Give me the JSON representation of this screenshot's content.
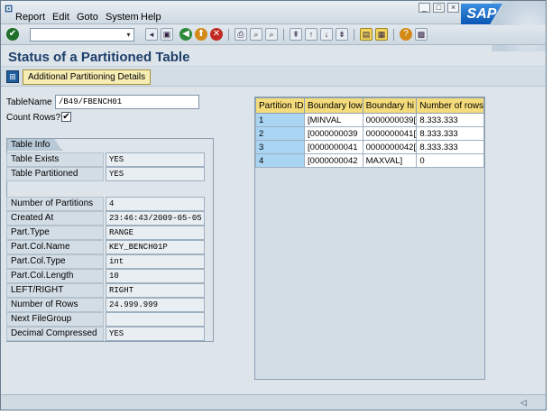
{
  "menu": {
    "items": [
      "Report",
      "Edit",
      "Goto",
      "System",
      "Help"
    ]
  },
  "window_buttons": [
    "minimize-icon",
    "restore-icon",
    "close-icon"
  ],
  "logo": "SAP",
  "toolbar": {
    "command_field_value": "",
    "icons": [
      "enter-icon",
      "save-icon",
      "back-icon",
      "exit-icon",
      "cancel-icon",
      "print-icon",
      "find-icon",
      "find-next-icon",
      "first-page-icon",
      "previous-page-icon",
      "next-page-icon",
      "last-page-icon",
      "new-session-icon",
      "shortcut-icon",
      "help-icon",
      "layout-icon"
    ]
  },
  "page": {
    "title": "Status of a Partitioned Table"
  },
  "app_toolbar": {
    "button_label": "Additional Partitioning Details"
  },
  "form": {
    "table_name_label": "TableName",
    "table_name_value": "/B49/FBENCH01",
    "count_rows_label": "Count Rows?",
    "count_rows_checked": true,
    "count_rows_mark": "✔"
  },
  "table_info": {
    "title": "Table Info",
    "rows": [
      {
        "label": "Table Exists",
        "value": "YES"
      },
      {
        "label": "Table Partitioned",
        "value": "YES"
      },
      {
        "label": "Number of Partitions",
        "value": "4"
      },
      {
        "label": "Created At",
        "value": "23:46:43/2009-05-05"
      },
      {
        "label": "Part.Type",
        "value": "RANGE"
      },
      {
        "label": "Part.Col.Name",
        "value": "KEY_BENCH01P"
      },
      {
        "label": "Part.Col.Type",
        "value": "int"
      },
      {
        "label": "Part.Col.Length",
        "value": "10"
      },
      {
        "label": "LEFT/RIGHT",
        "value": "RIGHT"
      },
      {
        "label": "Number of Rows",
        "value": "24.999.999"
      },
      {
        "label": "Next FileGroup",
        "value": ""
      },
      {
        "label": "Decimal Compressed",
        "value": "YES"
      }
    ]
  },
  "partitions": {
    "headers": [
      "Partition ID",
      "Boundary low",
      "Boundary hi",
      "Number of rows"
    ],
    "rows": [
      [
        "1",
        "[MINVAL",
        "0000000039[",
        "8.333.333"
      ],
      [
        "2",
        "[0000000039",
        "0000000041[",
        "8.333.333"
      ],
      [
        "3",
        "[0000000041",
        "0000000042[",
        "8.333.333"
      ],
      [
        "4",
        "[0000000042",
        "MAXVAL]",
        "0"
      ]
    ]
  },
  "colors": {
    "title": "#1d3f6a",
    "header_yellow": "#f4dc7c",
    "id_cell_blue": "#a9d4f2",
    "background": "#dde4ea"
  }
}
